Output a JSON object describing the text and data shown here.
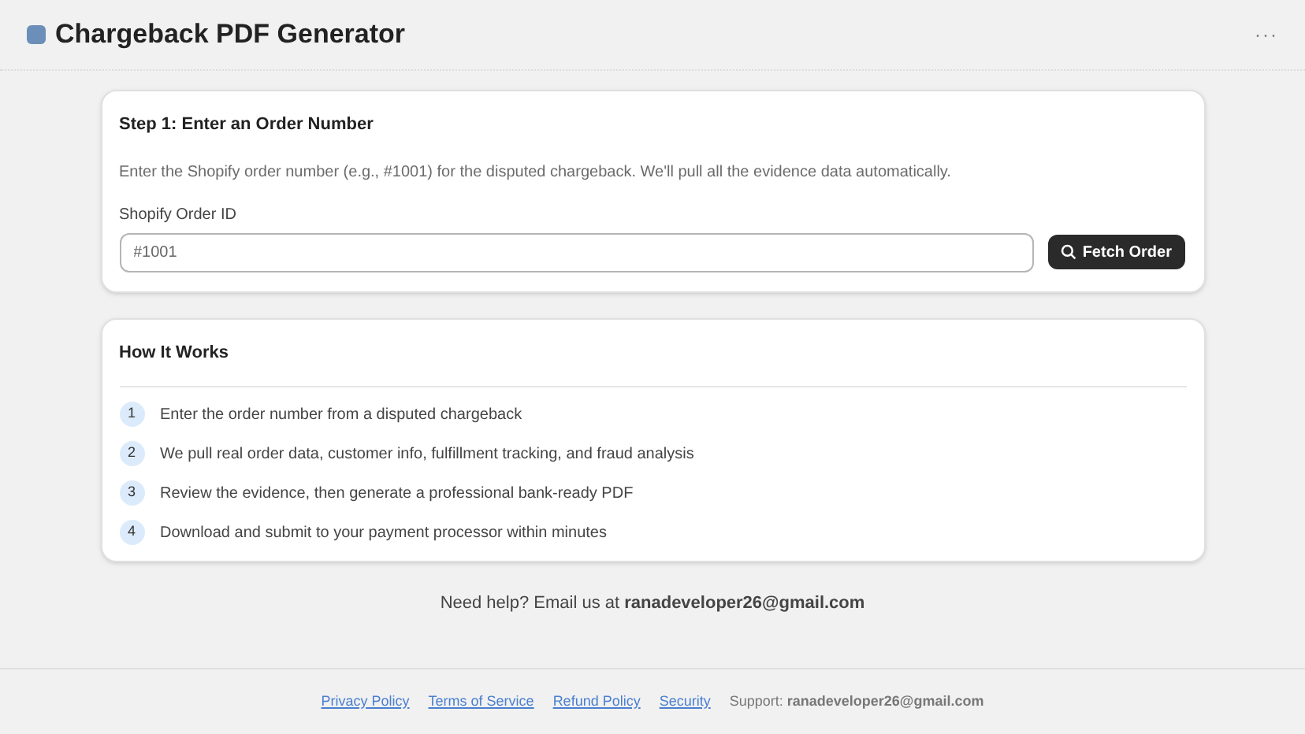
{
  "header": {
    "title": "Chargeback PDF Generator",
    "menu": "···"
  },
  "step_card": {
    "title": "Step 1: Enter an Order Number",
    "description": "Enter the Shopify order number (e.g., #1001) for the disputed chargeback. We'll pull all the evidence data automatically.",
    "field_label": "Shopify Order ID",
    "placeholder": "#1001",
    "button": "Fetch Order"
  },
  "how_card": {
    "title": "How It Works",
    "steps": [
      {
        "number": "1",
        "text": "Enter the order number from a disputed chargeback"
      },
      {
        "number": "2",
        "text": "We pull real order data, customer info, fulfillment tracking, and fraud analysis"
      },
      {
        "number": "3",
        "text": "Review the evidence, then generate a professional bank-ready PDF"
      },
      {
        "number": "4",
        "text": "Download and submit to your payment processor within minutes"
      }
    ]
  },
  "help": "Need help? Email us at **ranadeveloper26@gmail.com**",
  "footer": {
    "links": [
      "Privacy Policy",
      "Terms of Service",
      "Refund Policy",
      "Security"
    ],
    "support": "Support: **ranadeveloper26@gmail.com**"
  }
}
